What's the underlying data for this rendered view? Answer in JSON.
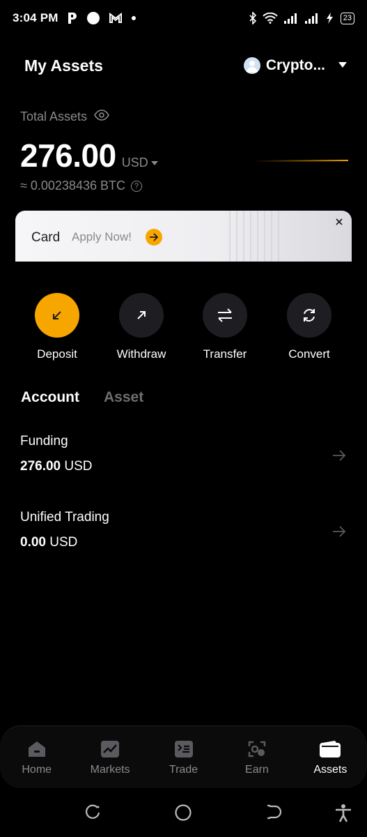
{
  "status_bar": {
    "time": "3:04 PM",
    "battery": "23",
    "icons": [
      "p-icon",
      "circle-icon",
      "gmail-icon",
      "dot-icon",
      "bluetooth-icon",
      "wifi-icon",
      "signal-icon",
      "signal-icon",
      "charging-icon",
      "battery-icon"
    ]
  },
  "header": {
    "title": "My Assets",
    "account_name": "Crypto...",
    "avatar_icon": "user-avatar-icon",
    "dropdown_icon": "caret-down-icon"
  },
  "total": {
    "label": "Total Assets",
    "amount": "276.00",
    "currency": "USD",
    "btc_equiv": "≈ 0.00238436 BTC",
    "help": "?"
  },
  "banner": {
    "title": "Card",
    "cta": "Apply Now!"
  },
  "actions": [
    {
      "label": "Deposit",
      "icon": "arrow-down-left-icon"
    },
    {
      "label": "Withdraw",
      "icon": "arrow-up-right-icon"
    },
    {
      "label": "Transfer",
      "icon": "swap-icon"
    },
    {
      "label": "Convert",
      "icon": "refresh-icon"
    }
  ],
  "tabs": [
    {
      "label": "Account",
      "active": true
    },
    {
      "label": "Asset",
      "active": false
    }
  ],
  "accounts": [
    {
      "name": "Funding",
      "amount": "276.00",
      "currency": "USD"
    },
    {
      "name": "Unified Trading",
      "amount": "0.00",
      "currency": "USD"
    }
  ],
  "bottom_nav": [
    {
      "label": "Home",
      "icon": "home-icon",
      "active": false
    },
    {
      "label": "Markets",
      "icon": "chart-icon",
      "active": false
    },
    {
      "label": "Trade",
      "icon": "trade-icon",
      "active": false
    },
    {
      "label": "Earn",
      "icon": "earn-icon",
      "active": false
    },
    {
      "label": "Assets",
      "icon": "wallet-icon",
      "active": true
    }
  ],
  "colors": {
    "accent": "#f7a600",
    "background": "#000000",
    "muted": "#8a8a8e"
  }
}
